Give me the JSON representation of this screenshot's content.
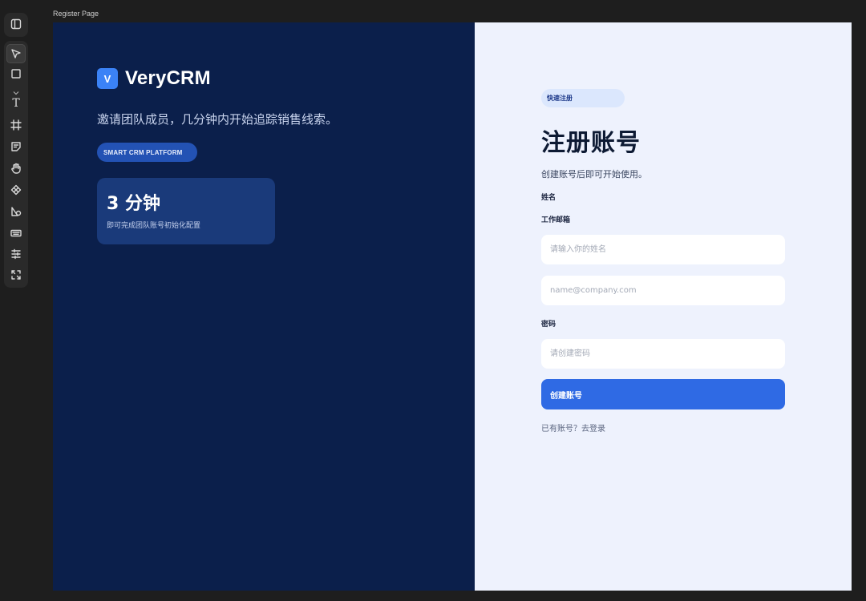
{
  "canvas": {
    "frame_label": "Register Page"
  },
  "toolbar": {
    "top_icon": "sidebar-toggle-icon",
    "tools": [
      {
        "name": "select-tool",
        "icon": "cursor-icon",
        "active": true
      },
      {
        "name": "rectangle-tool",
        "icon": "square-icon"
      },
      {
        "name": "text-tool",
        "icon": "text-icon",
        "glyph": "T"
      },
      {
        "name": "frame-tool",
        "icon": "frame-icon"
      },
      {
        "name": "sticky-note-tool",
        "icon": "note-icon"
      },
      {
        "name": "hand-tool",
        "icon": "hand-icon"
      },
      {
        "name": "component-tool",
        "icon": "component-icon"
      },
      {
        "name": "shapes-tool",
        "icon": "shapes-icon"
      },
      {
        "name": "keyboard-tool",
        "icon": "keyboard-icon"
      },
      {
        "name": "adjust-tool",
        "icon": "sliders-icon"
      },
      {
        "name": "fit-tool",
        "icon": "expand-icon"
      }
    ]
  },
  "brand": {
    "logo_letter": "V",
    "name": "VeryCRM",
    "tagline": "邀请团队成员，几分钟内开始追踪销售线索。",
    "platform_pill": "SMART CRM PLATFORM"
  },
  "stat_card": {
    "value": "3 分钟",
    "caption": "即可完成团队账号初始化配置"
  },
  "form": {
    "badge": "快速注册",
    "title": "注册账号",
    "subtitle": "创建账号后即可开始使用。",
    "name_label": "姓名",
    "email_label": "工作邮箱",
    "name_placeholder": "请输入你的姓名",
    "email_placeholder": "name@company.com",
    "password_label": "密码",
    "password_placeholder": "请创建密码",
    "submit_label": "创建账号",
    "login_link": "已有账号？去登录"
  },
  "colors": {
    "left_panel_bg": "#0b1f4b",
    "right_panel_bg": "#eef2fd",
    "accent": "#2f6ae4",
    "logo": "#3b82f6"
  }
}
